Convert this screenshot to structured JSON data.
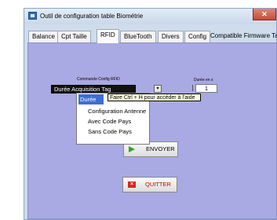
{
  "window": {
    "title": "Outil de configuration table Biométrie",
    "close_label": "✕"
  },
  "tabs": [
    {
      "label": "Balance"
    },
    {
      "label": "Cpt Taille"
    },
    {
      "label": "RFID",
      "active": true
    },
    {
      "label": "BlueTooth"
    },
    {
      "label": "Divers"
    },
    {
      "label": "Config"
    },
    {
      "label": "Compatible Firmware Ta"
    }
  ],
  "rfid": {
    "command_label": "Commande Config RFID",
    "command_value": "Durée Acquisition Tag",
    "duration_label": "Durée en s",
    "duration_value": "1",
    "dropdown_items": [
      {
        "label": "Durée",
        "selected": true
      },
      {
        "label": "Configuration  Antenne"
      },
      {
        "label": "Avec Code Pays"
      },
      {
        "label": "Sans Code Pays"
      }
    ],
    "tooltip": "Faire Ctrl + H pour accéder à l'aide"
  },
  "buttons": {
    "send_label": "ENVOYER",
    "quit_label": "QUITTER"
  }
}
